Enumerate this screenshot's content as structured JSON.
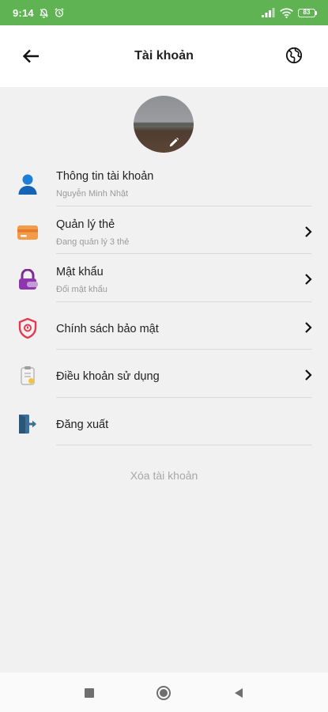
{
  "status_bar": {
    "time": "9:14",
    "battery": "83",
    "color": "#5fb353"
  },
  "header": {
    "title": "Tài khoản",
    "back_icon": "arrow-left-icon",
    "right_icon": "globe-icon"
  },
  "profile": {
    "edit_icon": "pencil-icon"
  },
  "menu": {
    "items": [
      {
        "title": "Thông tin tài khoản",
        "subtitle": "Nguyễn Minh Nhật",
        "icon": "user-icon",
        "has_chevron": false
      },
      {
        "title": "Quản lý thẻ",
        "subtitle": "Đang quản lý 3 thẻ",
        "icon": "card-icon",
        "has_chevron": true
      },
      {
        "title": "Mật khẩu",
        "subtitle": "Đổi mật khẩu",
        "icon": "lock-icon",
        "has_chevron": true
      },
      {
        "title": "Chính sách bảo mật",
        "subtitle": "",
        "icon": "shield-icon",
        "has_chevron": true
      },
      {
        "title": "Điều khoản sử dụng",
        "subtitle": "",
        "icon": "document-icon",
        "has_chevron": true
      },
      {
        "title": "Đăng xuất",
        "subtitle": "",
        "icon": "logout-icon",
        "has_chevron": false
      }
    ]
  },
  "delete_account": "Xóa tài khoản",
  "nav": {
    "recent_icon": "square-icon",
    "home_icon": "circle-icon",
    "back_icon": "triangle-back-icon"
  }
}
